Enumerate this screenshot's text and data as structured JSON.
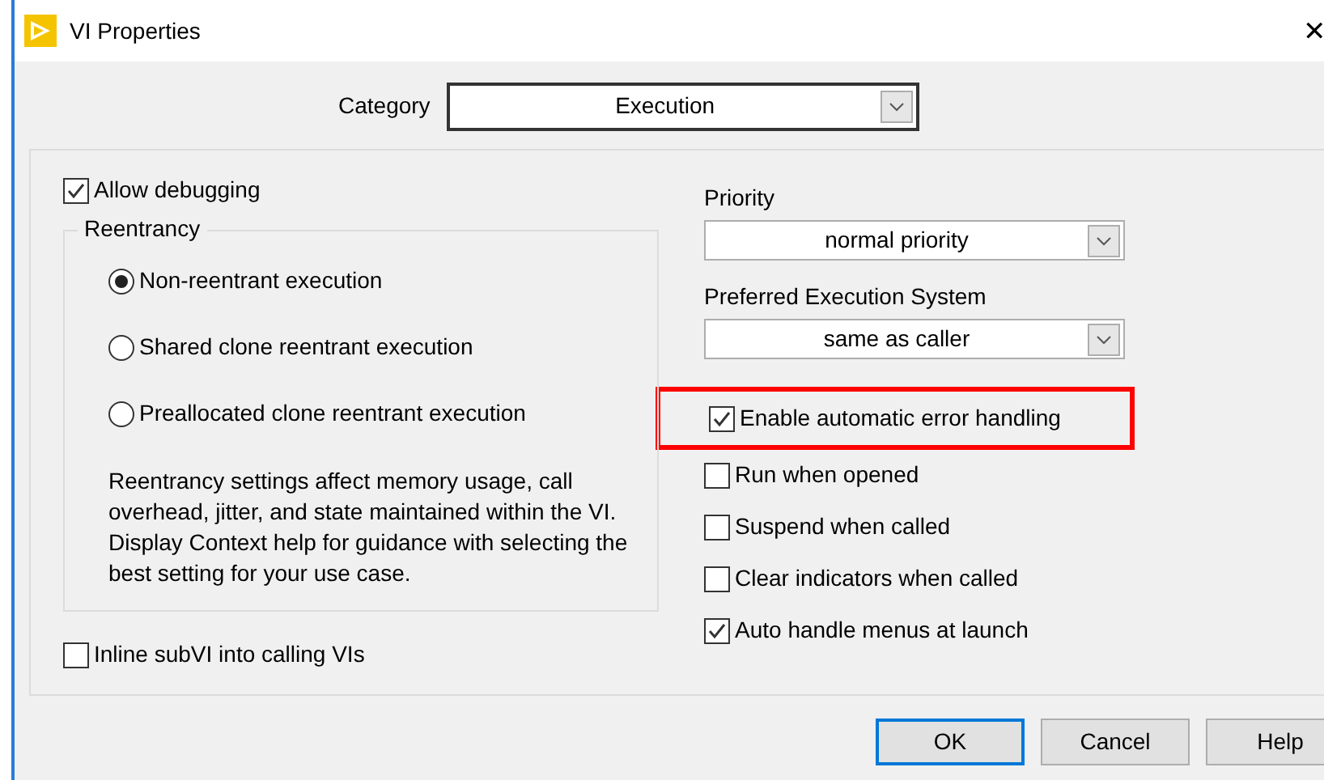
{
  "window": {
    "title": "VI Properties",
    "close": "✕"
  },
  "category": {
    "label": "Category",
    "value": "Execution"
  },
  "allow_debugging": {
    "label": "Allow debugging",
    "checked": true
  },
  "reentrancy": {
    "title": "Reentrancy",
    "options": [
      {
        "label": "Non-reentrant execution",
        "selected": true
      },
      {
        "label": "Shared clone reentrant execution",
        "selected": false
      },
      {
        "label": "Preallocated clone reentrant execution",
        "selected": false
      }
    ],
    "description": "Reentrancy settings affect memory usage, call overhead, jitter, and state maintained within the VI. Display Context help for guidance with selecting the best setting for your use case."
  },
  "inline_subvi": {
    "label": "Inline subVI into calling VIs",
    "checked": false
  },
  "priority": {
    "label": "Priority",
    "value": "normal priority"
  },
  "execution_system": {
    "label": "Preferred Execution System",
    "value": "same as caller"
  },
  "options": [
    {
      "label": "Enable automatic error handling",
      "checked": true,
      "highlighted": true
    },
    {
      "label": "Run when opened",
      "checked": false,
      "highlighted": false
    },
    {
      "label": "Suspend when called",
      "checked": false,
      "highlighted": false
    },
    {
      "label": "Clear indicators when called",
      "checked": false,
      "highlighted": false
    },
    {
      "label": "Auto handle menus at launch",
      "checked": true,
      "highlighted": false
    }
  ],
  "buttons": [
    {
      "label": "OK",
      "default": true
    },
    {
      "label": "Cancel",
      "default": false
    },
    {
      "label": "Help",
      "default": false
    }
  ]
}
